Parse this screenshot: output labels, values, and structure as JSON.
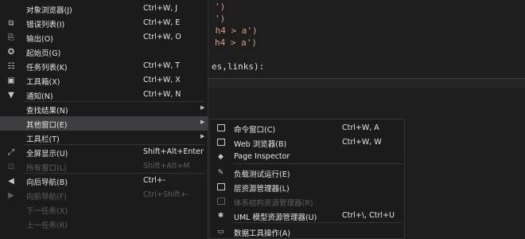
{
  "editor": {
    "lines": [
      {
        "text": "')",
        "kind": "string"
      },
      {
        "text": "')",
        "kind": "string"
      },
      {
        "text": " h4 > a')",
        "kind": "string"
      },
      {
        "text": "h4 > a')",
        "kind": "string"
      },
      {
        "text": "es,links):",
        "kind": "plain"
      }
    ]
  },
  "menu": {
    "items": [
      {
        "icon": "object-browser-icon",
        "glyph": "",
        "label": "对象浏览器(J)",
        "shortcut": "Ctrl+W, J",
        "arrow": false,
        "disabled": false
      },
      {
        "icon": "error-list-icon",
        "glyph": "⧉",
        "label": "错误列表(I)",
        "shortcut": "Ctrl+W, E",
        "arrow": false,
        "disabled": false
      },
      {
        "icon": "output-icon",
        "glyph": "⎘",
        "label": "输出(O)",
        "shortcut": "Ctrl+W, O",
        "arrow": false,
        "disabled": false
      },
      {
        "icon": "start-page-icon",
        "glyph": "✪",
        "label": "起始页(G)",
        "shortcut": "",
        "arrow": false,
        "disabled": false
      },
      {
        "icon": "task-list-icon",
        "glyph": "☷",
        "label": "任务列表(K)",
        "shortcut": "Ctrl+W, T",
        "arrow": false,
        "disabled": false
      },
      {
        "icon": "toolbox-icon",
        "glyph": "▣",
        "label": "工具箱(X)",
        "shortcut": "Ctrl+W, X",
        "arrow": false,
        "disabled": false
      },
      {
        "icon": "notification-icon",
        "glyph": "▼",
        "label": "通知(N)",
        "shortcut": "Ctrl+W, N",
        "arrow": false,
        "disabled": false
      },
      {
        "icon": "",
        "glyph": "",
        "label": "查找结果(N)",
        "shortcut": "",
        "arrow": true,
        "disabled": false
      },
      {
        "icon": "",
        "glyph": "",
        "label": "其他窗口(E)",
        "shortcut": "",
        "arrow": true,
        "disabled": false
      },
      {
        "icon": "",
        "glyph": "",
        "label": "工具栏(T)",
        "shortcut": "",
        "arrow": true,
        "disabled": false
      },
      {
        "icon": "full-screen-icon",
        "glyph": "⤢",
        "label": "全屏显示(U)",
        "shortcut": "Shift+Alt+Enter",
        "arrow": false,
        "disabled": false
      },
      {
        "icon": "all-windows-icon",
        "glyph": "⊡",
        "label": "所有窗口(L)",
        "shortcut": "Shift+Alt+M",
        "arrow": false,
        "disabled": true
      },
      {
        "icon": "navigate-backward-icon",
        "glyph": "◀",
        "label": "向后导航(B)",
        "shortcut": "Ctrl+-",
        "arrow": false,
        "disabled": false
      },
      {
        "icon": "navigate-forward-icon",
        "glyph": "▶",
        "label": "向前导航(F)",
        "shortcut": "Ctrl+Shift+-",
        "arrow": false,
        "disabled": true
      },
      {
        "icon": "",
        "glyph": "",
        "label": "下一任务(X)",
        "shortcut": "",
        "arrow": false,
        "disabled": true
      },
      {
        "icon": "",
        "glyph": "",
        "label": "上一任务(R)",
        "shortcut": "",
        "arrow": false,
        "disabled": true
      }
    ],
    "highlighted": "其他窗口(E)"
  },
  "submenu": {
    "items": [
      {
        "icon": "command-window-icon",
        "glyph": "box",
        "label": "命令窗口(C)",
        "shortcut": "Ctrl+W, A",
        "disabled": false
      },
      {
        "icon": "web-browser-icon",
        "glyph": "box",
        "label": "Web 浏览器(B)",
        "shortcut": "Ctrl+W, W",
        "disabled": false
      },
      {
        "icon": "page-inspector-icon",
        "glyph": "◆",
        "label": "Page Inspector",
        "shortcut": "",
        "disabled": false
      },
      {
        "icon": "load-test-icon",
        "glyph": "✎",
        "label": "负载测试运行(E)",
        "shortcut": "",
        "disabled": false
      },
      {
        "icon": "layer-explorer-icon",
        "glyph": "box",
        "label": "层资源管理器(L)",
        "shortcut": "",
        "disabled": false
      },
      {
        "icon": "architecture-explorer-icon",
        "glyph": "dimbox",
        "label": "体系结构资源管理器(R)",
        "shortcut": "",
        "disabled": true
      },
      {
        "icon": "uml-model-explorer-icon",
        "glyph": "✱",
        "label": "UML 模型资源管理器(U)",
        "shortcut": "Ctrl+\\, Ctrl+U",
        "disabled": false
      },
      {
        "icon": "data-tools-icon",
        "glyph": "▭",
        "label": "数据工具操作(A)",
        "shortcut": "",
        "disabled": false
      }
    ]
  }
}
